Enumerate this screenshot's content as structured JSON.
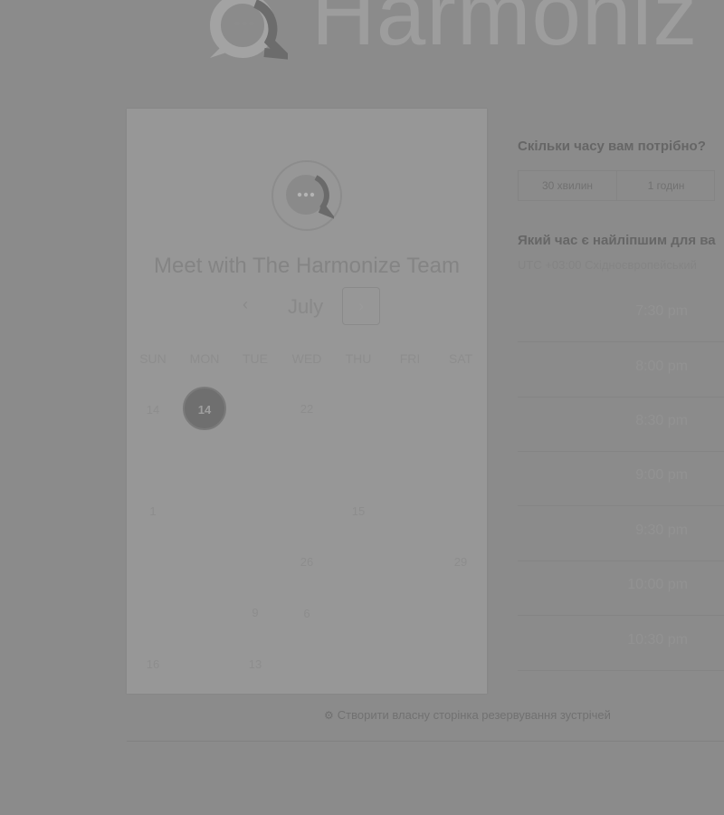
{
  "brand": {
    "name": "Harmoniz",
    "logo_icon": "chat-bubble-logo-icon"
  },
  "calendar": {
    "avatar_icon": "chat-bubble-avatar-icon",
    "title": "Meet with The Harmonize Team",
    "month": "July",
    "prev_icon": "‹",
    "next_icon": "›",
    "weekdays": [
      "SUN",
      "MON",
      "TUE",
      "WED",
      "THU",
      "FRI",
      "SAT"
    ],
    "days": {
      "r1_sun": "14",
      "r1_mon": "14",
      "r1_wed": "22",
      "r3_sun": "1",
      "r3_thu": "15",
      "r4_wed": "26",
      "r4_sat": "29",
      "r5_tue": "9",
      "r5_wed": "6",
      "r6_sun": "16",
      "r6_tue": "13"
    },
    "selected_day": "14"
  },
  "duration": {
    "heading": "Скільки часу вам потрібно?",
    "options": [
      "30 хвилин",
      "1 годин"
    ]
  },
  "time": {
    "heading": "Який час є найліпшим для ва",
    "timezone": "UTC +03:00 Східноєвропейський",
    "slots": [
      "7:30 pm",
      "8:00 pm",
      "8:30 pm",
      "9:00 pm",
      "9:30 pm",
      "10:00 pm",
      "10:30 pm"
    ]
  },
  "footer": {
    "link_text": "Створити власну сторінка резервування зустрічей",
    "icon": "sprocket-icon"
  },
  "colors": {
    "background": "#8b8b8b",
    "panel": "#979797",
    "selected_day": "#6f6f6f"
  }
}
